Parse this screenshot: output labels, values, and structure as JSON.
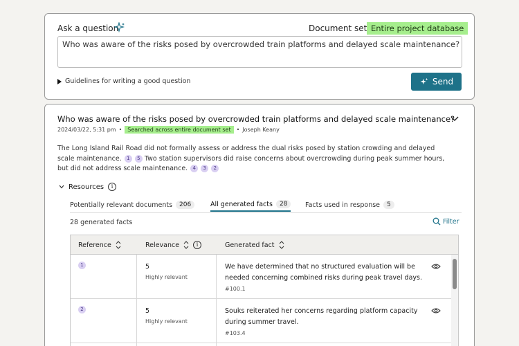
{
  "ask": {
    "title": "Ask a question",
    "docset_label": "Document set",
    "docset_value": "Entire project database",
    "question_value": "Who was aware of the risks posed by overcrowded train platforms and delayed scale maintenance?",
    "guidelines_label": "Guidelines for writing a good question",
    "send_label": "Send"
  },
  "answer": {
    "question": "Who was aware of the risks posed by overcrowded train platforms and delayed scale maintenance?",
    "timestamp": "2024/03/22, 5:31 pm",
    "scope_badge": "Searched across entire document set",
    "author": "Joseph Keany",
    "text_part1": "The Long Island Rail Road did not formally assess or address the dual risks posed by station crowding and delayed scale maintenance.",
    "cites1": [
      "1",
      "5"
    ],
    "text_part2": "Two station supervisors did raise concerns about overcrowding during peak summer hours, but did not address scale maintenance.",
    "cites2": [
      "4",
      "3",
      "2"
    ]
  },
  "resources": {
    "label": "Resources",
    "tabs": [
      {
        "label": "Potentially relevant documents",
        "count": "206",
        "active": false
      },
      {
        "label": "All generated facts",
        "count": "28",
        "active": true
      },
      {
        "label": "Facts used in response",
        "count": "5",
        "active": false
      }
    ],
    "facts_count": "28 generated facts",
    "filter_label": "Filter"
  },
  "table": {
    "headers": {
      "reference": "Reference",
      "relevance": "Relevance",
      "fact": "Generated fact"
    },
    "rows": [
      {
        "ref": "1",
        "score": "5",
        "relevance": "Highly relevant",
        "fact": "We have determined that no structured evaluation will be needed concerning combined risks during peak travel days.",
        "id": "#100.1"
      },
      {
        "ref": "2",
        "score": "5",
        "relevance": "Highly relevant",
        "fact": "Souks reiterated her concerns regarding platform capacity during summer travel.",
        "id": "#103.4"
      }
    ]
  },
  "colors": {
    "accent": "#1e7289",
    "badge_green": "#a6ee8d",
    "citation": "#d9cff2"
  }
}
